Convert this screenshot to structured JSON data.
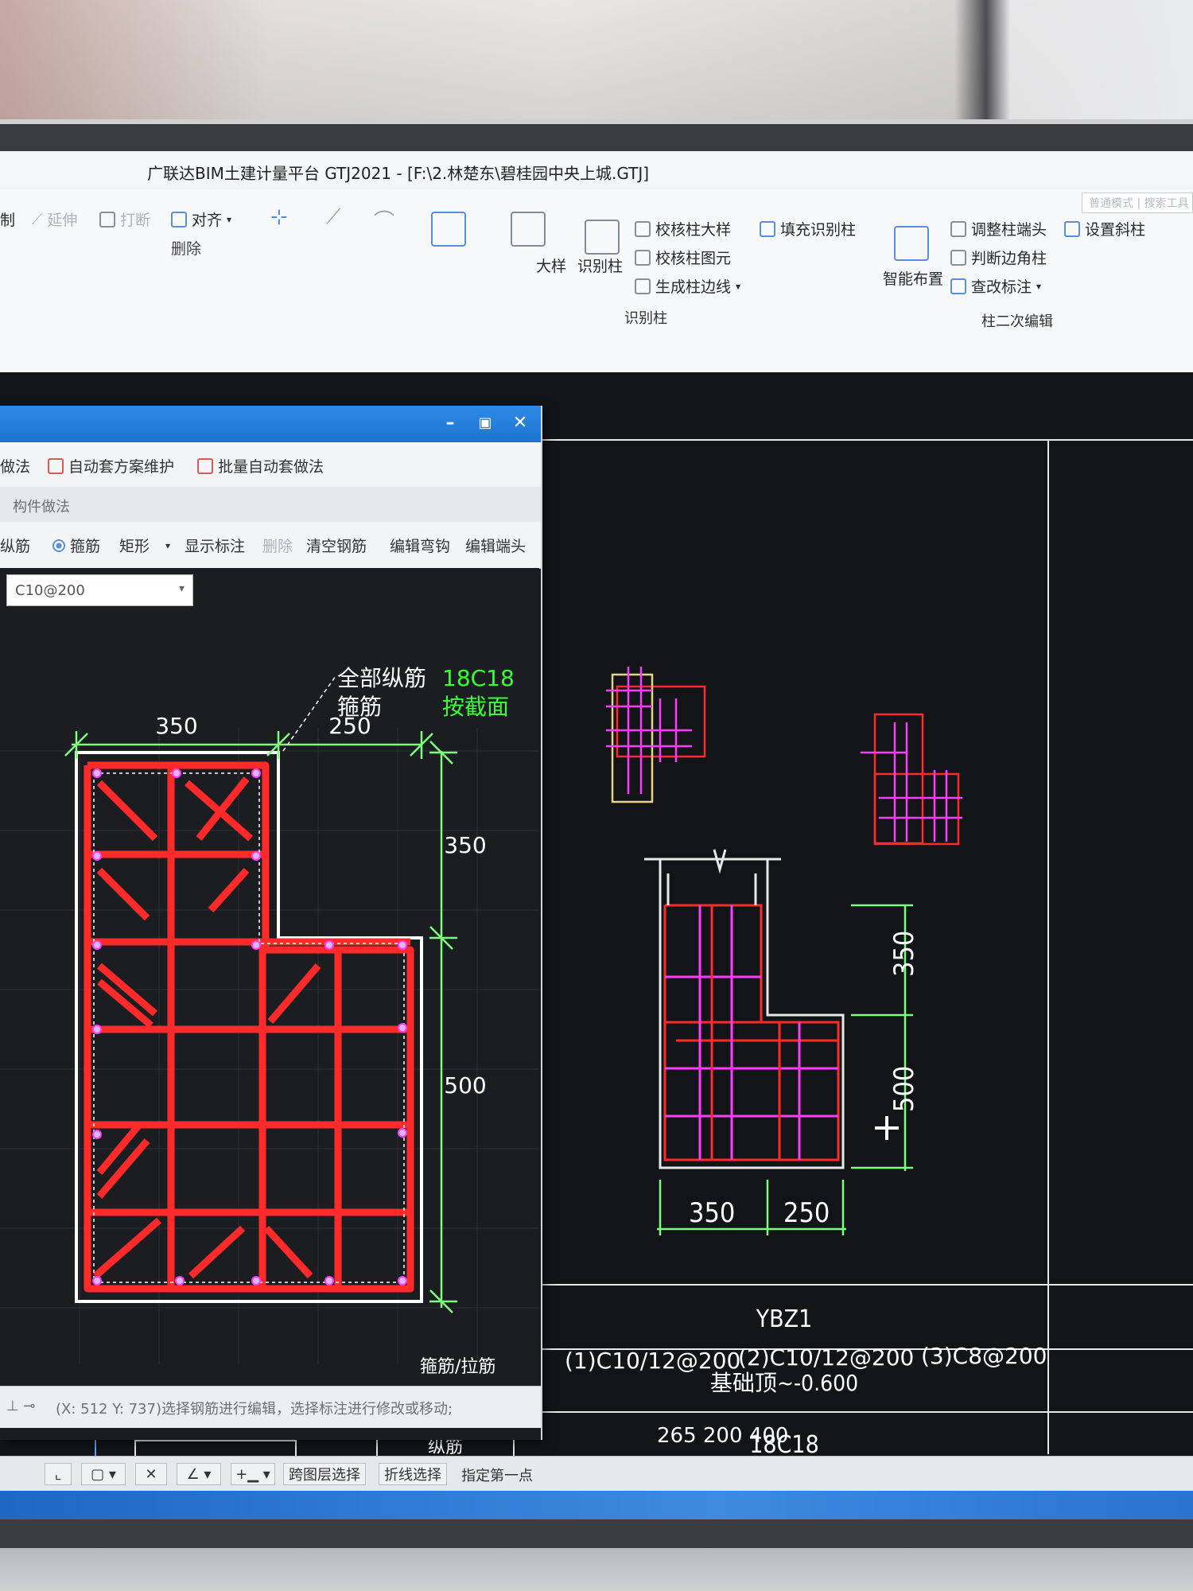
{
  "window": {
    "title": "广联达BIM土建计量平台 GTJ2021 - [F:\\2.林楚东\\碧桂园中央上城.GTJ]",
    "top_right_tabs": "普通模式 | 搜索工具"
  },
  "ribbon": {
    "left_items": [
      "制",
      "延伸",
      "打断",
      "对齐"
    ],
    "truncated_items": [
      "删除"
    ],
    "recognize_group": {
      "label": "识别柱",
      "items": [
        "大样",
        "识别柱",
        "校核柱大样",
        "校核柱图元",
        "生成柱边线",
        "填充识别柱"
      ]
    },
    "secondary_group": {
      "label": "柱二次编辑",
      "items": [
        "智能布置",
        "调整柱端头",
        "判断边角柱",
        "查改标注",
        "设置斜柱"
      ]
    }
  },
  "dialog": {
    "toolbar": [
      "做法",
      "自动套方案维护",
      "批量自动套做法"
    ],
    "section_label": "构件做法",
    "subtools": {
      "longitudinal": "纵筋",
      "stirrup": "箍筋",
      "shape": "矩形",
      "show_annotation": "显示标注",
      "delete": "删除",
      "clear_rebar": "清空钢筋",
      "edit_hook": "编辑弯钩",
      "edit_end": "编辑端头"
    },
    "stirrup_combo_value": "C10@200",
    "annotation": {
      "line1_label": "全部纵筋",
      "line1_value": "18C18",
      "line2_label": "箍筋",
      "line2_value": "按截面"
    },
    "dims": {
      "top_left": "350",
      "top_right": "250",
      "right_top": "350",
      "right_bottom": "500"
    },
    "status_text": "(X: 512 Y: 737)选择钢筋进行编辑，选择标注进行修改或移动;"
  },
  "drawing": {
    "section_dims": {
      "bottom_left": "350",
      "bottom_right": "250",
      "right_top": "350",
      "right_bottom": "500"
    },
    "table": {
      "name": "YBZ1",
      "elevation": "基础顶~-0.600",
      "row_label_1": "纵筋",
      "longitudinal": "18C18",
      "row_label_2": "箍筋/拉筋",
      "stirrups": [
        "(1)C10/12@200",
        "(2)C10/12@200",
        "(3)C8@200"
      ],
      "partial_bottom_row": "265  200  400"
    }
  },
  "bottom_toolbar": {
    "items": [
      "跨图层选择",
      "折线选择",
      "指定第一点"
    ]
  },
  "colors": {
    "rebar_red": "#ff2a2a",
    "rebar_magenta": "#ff3cff",
    "dimension_green": "#7dff7d",
    "annotation_green": "#39ff39",
    "title_blue": "#1c74d0"
  }
}
